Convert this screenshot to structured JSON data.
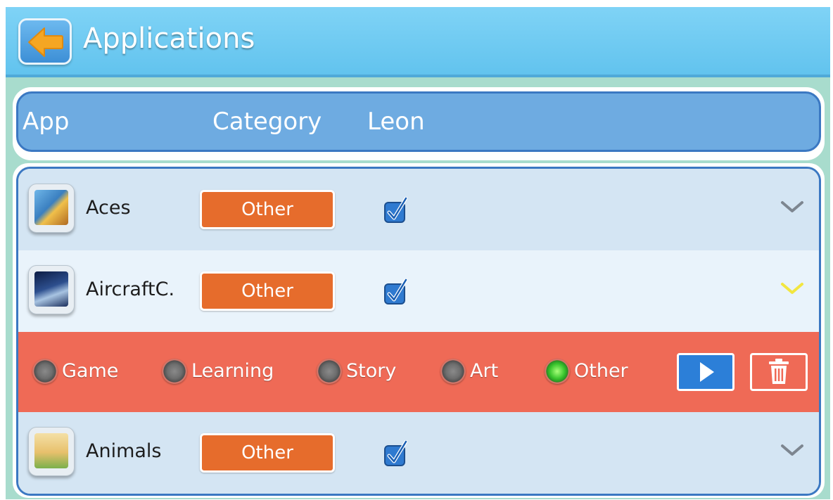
{
  "header": {
    "title": "Applications"
  },
  "columns": {
    "app": "App",
    "category": "Category",
    "user": "Leon"
  },
  "apps": [
    {
      "name": "Aces",
      "category": "Other",
      "checked": true,
      "icon": "aces-app-icon"
    },
    {
      "name": "AircraftC.",
      "category": "Other",
      "checked": true,
      "icon": "aircraft-app-icon"
    },
    {
      "name": "Animals",
      "category": "Other",
      "checked": true,
      "icon": "animals-app-icon"
    }
  ],
  "category_options": [
    {
      "label": "Game",
      "selected": false
    },
    {
      "label": "Learning",
      "selected": false
    },
    {
      "label": "Story",
      "selected": false
    },
    {
      "label": "Art",
      "selected": false
    },
    {
      "label": "Other",
      "selected": true
    }
  ],
  "colors": {
    "topbar": "#62c3ee",
    "header_bar": "#6eabe1",
    "category_button": "#e66c2c",
    "expanded_panel": "#ef6a56",
    "play_button": "#2c7fd8",
    "back_arrow": "#f5a623"
  }
}
